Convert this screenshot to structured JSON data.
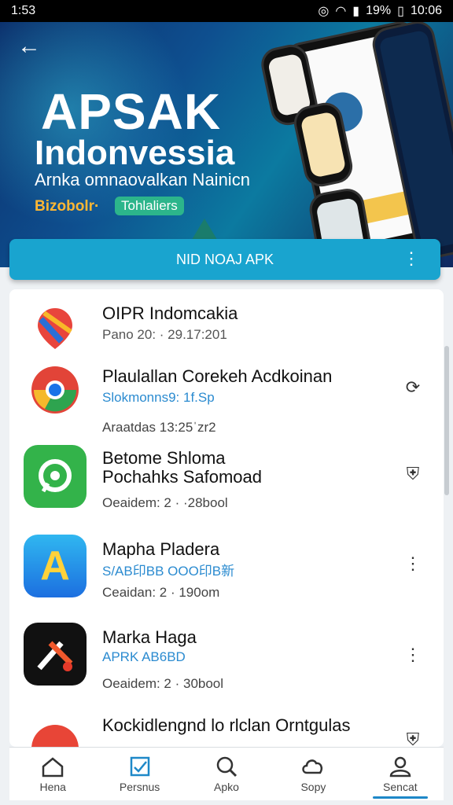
{
  "status": {
    "time": "1:53",
    "battery": "19%",
    "clock": "10:06"
  },
  "hero": {
    "title": "APSAK",
    "subtitle": "Indonvessia",
    "tagline": "Arnka omnaovalkan Nainicn",
    "tag_a": "Bizobolr·",
    "tag_b": "Tohlaliers"
  },
  "cta": {
    "label": "NID NOAJ APK"
  },
  "apps": [
    {
      "name": "OIPR Indomcakia",
      "line2": "Pano 20: · 29.17:201",
      "line3": "",
      "icon": "maps-pin-icon"
    },
    {
      "name": "Plaulallan Corekeh Acdkoinan",
      "line2": "Slokmonns9: 1f.Sp",
      "line3": "Araatdas 13:25ˈzr2",
      "icon": "chrome-icon"
    },
    {
      "name": "Betome Shloma",
      "name2": "Pochahks Safomoad",
      "line2": "Oeaidem: 2 · ·28bool",
      "line3": "",
      "icon": "whatsapp-icon"
    },
    {
      "name": "Mapha Pladera",
      "line2": "S/AB印BB OOO印B新",
      "line3": "Ceaidan: 2 · 190om",
      "icon": "app-store-icon"
    },
    {
      "name": "Marka Haga",
      "line2": "APRK AB6BD",
      "line3": "Oeaidem: 2 · 30bool",
      "icon": "media-app-icon"
    },
    {
      "name": "Kockidlengnd lo rlclan Orntgulas",
      "line2": "",
      "line3": "",
      "icon": "red-app-icon"
    }
  ],
  "nav": [
    {
      "label": "Hena",
      "icon": "home-icon"
    },
    {
      "label": "Persnus",
      "icon": "checkbox-icon"
    },
    {
      "label": "Apko",
      "icon": "search-icon"
    },
    {
      "label": "Sopy",
      "icon": "cloud-icon"
    },
    {
      "label": "Sencat",
      "icon": "profile-icon"
    }
  ]
}
